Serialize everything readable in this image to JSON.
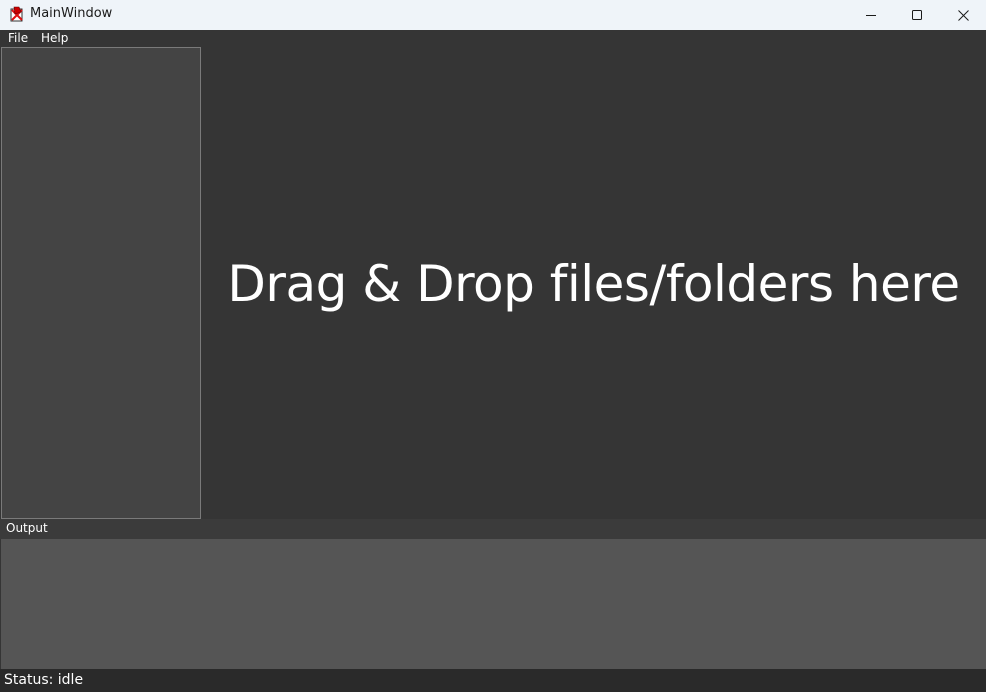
{
  "window": {
    "title": "MainWindow",
    "app_icon": "app-icon",
    "controls": {
      "minimize_icon": "minimize-icon",
      "maximize_icon": "maximize-icon",
      "close_icon": "close-icon"
    }
  },
  "menubar": {
    "items": [
      {
        "label": "File"
      },
      {
        "label": "Help"
      }
    ]
  },
  "drop_zone": {
    "text": "Drag & Drop files/folders here"
  },
  "output": {
    "label": "Output",
    "content": ""
  },
  "status": {
    "text": "Status: idle"
  },
  "colors": {
    "titlebar_bg": "#eff4f9",
    "window_bg": "#353535",
    "left_panel_bg": "#444444",
    "output_bg": "#555555",
    "status_bg": "#2a2a2a",
    "text": "#ffffff"
  }
}
